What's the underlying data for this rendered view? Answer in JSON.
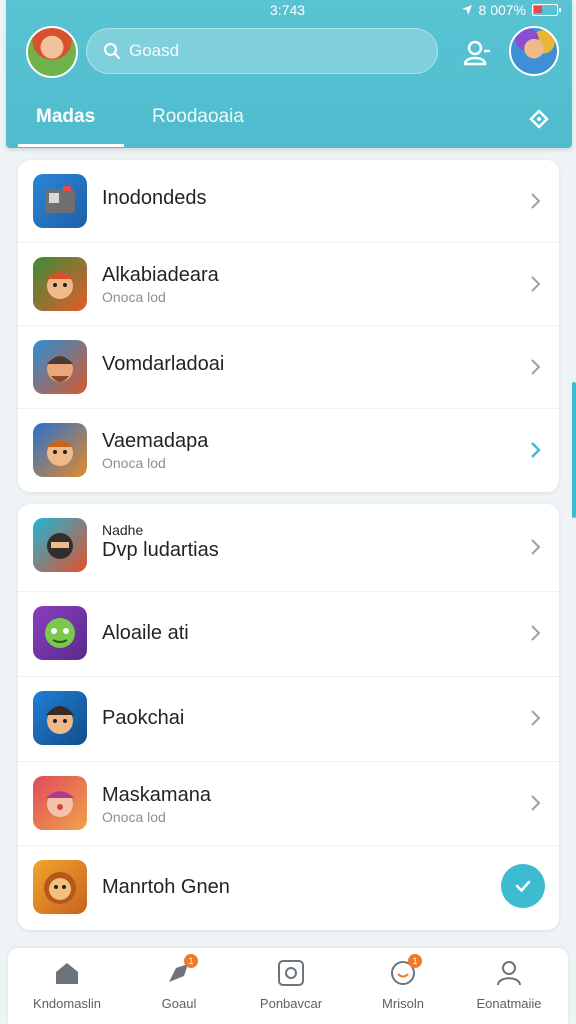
{
  "status": {
    "time": "3:743",
    "battery_text": "8 007%"
  },
  "search": {
    "placeholder": "Goasd"
  },
  "tabs": [
    {
      "label": "Madas",
      "active": true
    },
    {
      "label": "Roodaoaia",
      "active": false
    }
  ],
  "list1": [
    {
      "title": "Inodondeds",
      "sub": "",
      "icon": "robot-app-icon",
      "colors": [
        "#2a86d8",
        "#6f6f6f"
      ]
    },
    {
      "title": "Alkabiadeara",
      "sub": "Onoca lod",
      "icon": "jungle-game-icon",
      "colors": [
        "#3b8c3a",
        "#e45b2b"
      ]
    },
    {
      "title": "Vomdarladoai",
      "sub": "",
      "icon": "dwarf-game-icon",
      "colors": [
        "#2c8fd6",
        "#d65a2c"
      ]
    },
    {
      "title": "Vaemadapa",
      "sub": "Onoca lod",
      "icon": "hero-game-icon",
      "colors": [
        "#2a6fcf",
        "#e28b2b"
      ],
      "highlight": true
    }
  ],
  "list2": [
    {
      "pre": "Nadhe",
      "title": "Dvp ludartias",
      "sub": "",
      "icon": "ninja-game-icon",
      "colors": [
        "#1fb7d6",
        "#e34f2b"
      ]
    },
    {
      "title": "Aloaile ati",
      "sub": "",
      "icon": "goblin-game-icon",
      "colors": [
        "#8a3fc1",
        "#5ec244"
      ]
    },
    {
      "title": "Paokchai",
      "sub": "",
      "icon": "boy-game-icon",
      "colors": [
        "#1f7fd6",
        "#3a2a25"
      ]
    },
    {
      "title": "Maskamana",
      "sub": "Onoca lod",
      "icon": "clown-game-icon",
      "colors": [
        "#e04a5a",
        "#f0a34a"
      ]
    },
    {
      "title": "Manrtoh Gnen",
      "sub": "",
      "icon": "lion-game-icon",
      "colors": [
        "#f2a52b",
        "#c8621f"
      ],
      "checked": true
    }
  ],
  "nav": [
    {
      "label": "Kndomaslin",
      "icon": "home-icon"
    },
    {
      "label": "Goaul",
      "icon": "rocket-icon",
      "badge": "1"
    },
    {
      "label": "Ponbavcar",
      "icon": "camera-icon"
    },
    {
      "label": "Mrisoln",
      "icon": "face-icon",
      "badge": "1"
    },
    {
      "label": "Eonatmaiie",
      "icon": "profile-icon"
    }
  ],
  "colors": {
    "accent": "#3dbbd0",
    "header": "#55c0d0",
    "badge": "#f07a2a"
  }
}
